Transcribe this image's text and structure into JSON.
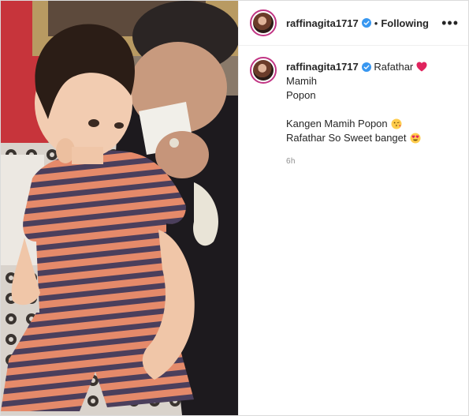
{
  "header": {
    "username": "raffinagita1717",
    "separator": "•",
    "follow_state": "Following",
    "more_icon": "more-options-icon"
  },
  "caption": {
    "username": "raffinagita1717",
    "line1_a": "Rafathar",
    "line1_b": "Mamih",
    "line2": "Popon",
    "line3": "Kangen Mamih Popon",
    "line4": "Rafathar So Sweet banget",
    "timestamp": "6h"
  },
  "icons": {
    "verified": "verified-badge-icon",
    "heart": "red-heart-emoji-icon",
    "kiss": "face-blowing-kiss-emoji-icon",
    "heart_eyes": "heart-eyes-emoji-icon"
  },
  "colors": {
    "verified_blue": "#3897f0",
    "avatar_ring": "#c13584",
    "heart_red": "#e0245e",
    "text": "#262626",
    "muted": "#8e8e8e"
  }
}
